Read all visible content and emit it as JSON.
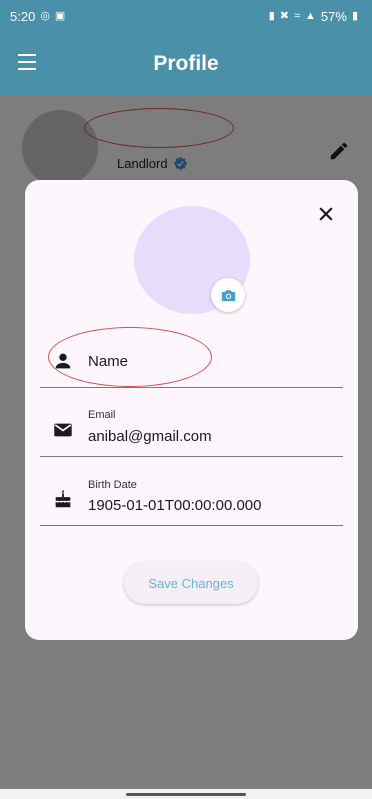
{
  "status_bar": {
    "time": "5:20",
    "battery": "57%",
    "icons": [
      "whatsapp-icon",
      "gallery-icon",
      "battery-saver-icon",
      "mute-icon",
      "wifi-icon",
      "signal-icon",
      "battery-icon"
    ]
  },
  "app_bar": {
    "title": "Profile",
    "menu_icon": "hamburger-menu-icon"
  },
  "profile": {
    "role": "Landlord",
    "verified_icon": "verified-badge-icon",
    "edit_icon": "pencil-icon"
  },
  "dialog": {
    "close_icon": "close-icon",
    "camera_icon": "camera-icon",
    "name_field": {
      "icon": "person-icon",
      "placeholder": "Name",
      "value": ""
    },
    "email_field": {
      "icon": "mail-icon",
      "label": "Email",
      "value": "anibal@gmail.com"
    },
    "birth_field": {
      "icon": "cake-icon",
      "label": "Birth Date",
      "value": "1905-01-01T00:00:00.000"
    },
    "save_label": "Save Changes"
  },
  "colors": {
    "primary": "#4a90a8",
    "accent_text": "#6cb3cf",
    "annotation": "#d94f4f",
    "avatar_placeholder": "#e7dcfb"
  }
}
